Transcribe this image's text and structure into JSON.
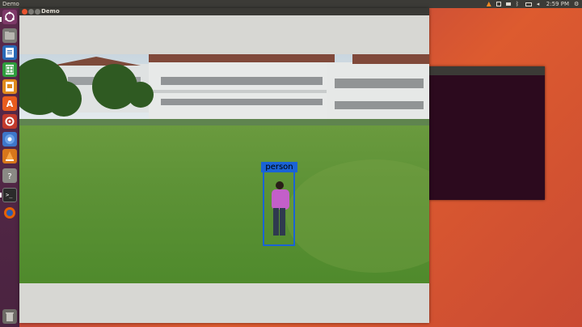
{
  "top_panel": {
    "app_name": "Demo",
    "clock": "2:59 PM",
    "tray_icons": [
      "vlc-icon",
      "network-icon",
      "keyboard-icon",
      "bluetooth-icon",
      "battery-icon",
      "volume-icon"
    ]
  },
  "launcher": {
    "items": [
      "ubuntu-dash-icon",
      "files-icon",
      "writer-icon",
      "calc-icon",
      "impress-icon",
      "software-center-icon",
      "settings-icon",
      "chromium-icon",
      "vlc-icon",
      "unknown-app-icon",
      "terminal-icon",
      "firefox-icon",
      "trash-icon"
    ]
  },
  "demo_window": {
    "title": "Demo",
    "detection": {
      "label": "person",
      "color": "#1a63d6"
    }
  }
}
